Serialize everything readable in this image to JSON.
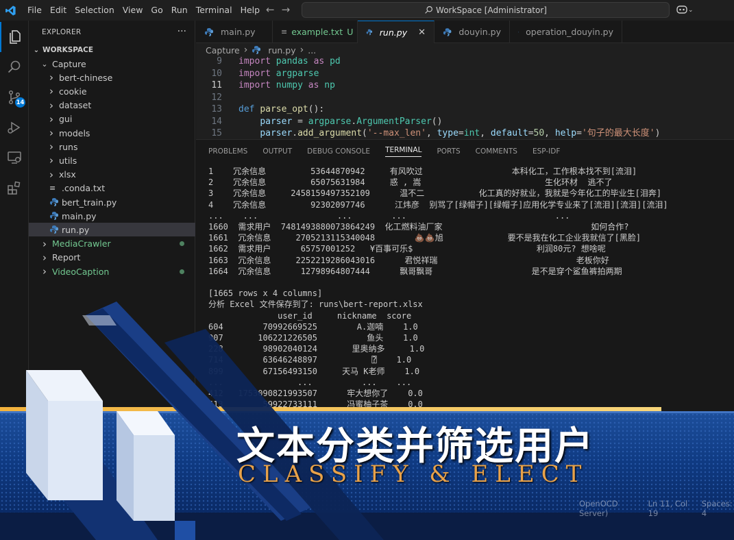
{
  "titlebar": {
    "menu": [
      "File",
      "Edit",
      "Selection",
      "View",
      "Go",
      "Run",
      "Terminal",
      "Help"
    ],
    "search": "WorkSpace [Administrator]"
  },
  "activity": {
    "scm_badge": "14"
  },
  "explorer": {
    "title": "EXPLORER",
    "root": "WORKSPACE",
    "items": [
      {
        "label": "Capture",
        "kind": "folder-open",
        "depth": 1
      },
      {
        "label": "bert-chinese",
        "kind": "folder",
        "depth": 2
      },
      {
        "label": "cookie",
        "kind": "folder",
        "depth": 2
      },
      {
        "label": "dataset",
        "kind": "folder",
        "depth": 2
      },
      {
        "label": "gui",
        "kind": "folder",
        "depth": 2
      },
      {
        "label": "models",
        "kind": "folder",
        "depth": 2
      },
      {
        "label": "runs",
        "kind": "folder",
        "depth": 2
      },
      {
        "label": "utils",
        "kind": "folder",
        "depth": 2
      },
      {
        "label": "xlsx",
        "kind": "folder",
        "depth": 2
      },
      {
        "label": ".conda.txt",
        "kind": "txt",
        "depth": 2
      },
      {
        "label": "bert_train.py",
        "kind": "py",
        "depth": 2
      },
      {
        "label": "main.py",
        "kind": "py",
        "depth": 2
      },
      {
        "label": "run.py",
        "kind": "py",
        "depth": 2,
        "selected": true
      },
      {
        "label": "MediaCrawler",
        "kind": "folder",
        "depth": 1,
        "color": "#73c991",
        "dot": true
      },
      {
        "label": "Report",
        "kind": "folder",
        "depth": 1
      },
      {
        "label": "VideoCaption",
        "kind": "folder",
        "depth": 1,
        "color": "#73c991",
        "dot": true
      }
    ]
  },
  "tabs": [
    {
      "label": "main.py",
      "icon": "python-icon"
    },
    {
      "label": "example.txt",
      "suffix": "U",
      "icon": "txt-icon"
    },
    {
      "label": "run.py",
      "icon": "python-icon",
      "active": true
    },
    {
      "label": "douyin.py",
      "icon": "python-icon"
    },
    {
      "label": "operation_douyin.py",
      "icon": "python-icon"
    }
  ],
  "breadcrumb": [
    "Capture",
    "run.py",
    "..."
  ],
  "editor": {
    "lines": [
      {
        "n": "9",
        "tokens": [
          [
            "kw",
            "import "
          ],
          [
            "mod",
            "pandas"
          ],
          [
            "kw",
            " as "
          ],
          [
            "mod",
            "pd"
          ]
        ]
      },
      {
        "n": "10",
        "tokens": [
          [
            "kw",
            "import "
          ],
          [
            "mod",
            "argparse"
          ]
        ]
      },
      {
        "n": "11",
        "tokens": [
          [
            "kw",
            "import "
          ],
          [
            "mod",
            "numpy"
          ],
          [
            "kw",
            " as "
          ],
          [
            "mod",
            "np"
          ]
        ],
        "current": true
      },
      {
        "n": "12",
        "tokens": []
      },
      {
        "n": "13",
        "tokens": [
          [
            "def",
            "def "
          ],
          [
            "fn",
            "parse_opt"
          ],
          [
            "plain",
            "():"
          ]
        ]
      },
      {
        "n": "14",
        "tokens": [
          [
            "plain",
            "    "
          ],
          [
            "var",
            "parser"
          ],
          [
            "plain",
            " = "
          ],
          [
            "mod",
            "argparse"
          ],
          [
            "plain",
            "."
          ],
          [
            "mod",
            "ArgumentParser"
          ],
          [
            "plain",
            "()"
          ]
        ]
      },
      {
        "n": "15",
        "tokens": [
          [
            "plain",
            "    "
          ],
          [
            "var",
            "parser"
          ],
          [
            "plain",
            "."
          ],
          [
            "fn",
            "add_argument"
          ],
          [
            "plain",
            "("
          ],
          [
            "str",
            "'--max_len'"
          ],
          [
            "plain",
            ", "
          ],
          [
            "var",
            "type"
          ],
          [
            "plain",
            "="
          ],
          [
            "mod",
            "int"
          ],
          [
            "plain",
            ", "
          ],
          [
            "var",
            "default"
          ],
          [
            "plain",
            "="
          ],
          [
            "num",
            "50"
          ],
          [
            "plain",
            ", "
          ],
          [
            "var",
            "help"
          ],
          [
            "plain",
            "="
          ],
          [
            "str",
            "'句子的最大长度'"
          ],
          [
            "plain",
            ")"
          ]
        ]
      }
    ]
  },
  "panel": {
    "tabs": [
      "PROBLEMS",
      "OUTPUT",
      "DEBUG CONSOLE",
      "TERMINAL",
      "PORTS",
      "COMMENTS",
      "ESP-IDF"
    ],
    "active_tab": "TERMINAL",
    "terminal": [
      "1    冗余信息         53644870942     有风吹过                  本科化工，工作根本找不到[流泪]",
      "2    冗余信息         65075631984     惑 , 嵩                         生化环材  逃不了",
      "3    冗余信息     2458159497352109      温不二           化工真的好就业，我就是今年化工的毕业生[泪奔]",
      "4    冗余信息         92302097746      江炜彦  别骂了[绿帽子][绿帽子]应用化学专业来了[流泪][流泪][流泪]",
      "...    ...                ...        ...                              ...",
      "1660  需求用户  7481493880073864249  化工燃料油厂家                              如何合作?",
      "1661  冗余信息     2705213115340048        💩💩旭             要不是我在化工企业我就信了[黑脸]",
      "1662  需求用户      65757001252   ¥百事可乐$                         利润80元? 想啥呢",
      "1663  冗余信息     2252219286043016      君悦祥瑞                            老板你好",
      "1664  冗余信息      12798964807444      飘哥飘哥                    是不是穿个鲨鱼裤拍两期",
      "",
      "[1665 rows x 4 columns]",
      "分析 Excel 文件保存到了: runs\\bert-report.xlsx",
      "              user_id     nickname  score",
      "604        70992669525        A.迦喃    1.0",
      "907       106221226505          鱼头    1.0",
      "228        98902040124       里奥纳多     1.0",
      "714        63646248897           ⍰    1.0",
      "899        67156493150     天马 K老师    1.0",
      "...               ...          ...    ...",
      "412   1753090821993507      牢大想你了    0.0",
      "413        59922733111      冯蜜柚子茶    0.0"
    ]
  },
  "overlay": {
    "title": "文本分类并筛选用户",
    "subtitle": "CLASSIFY & ELECT",
    "status_items": [
      "OpenOCD Server)",
      "Ln 11, Col 19",
      "Spaces: 4"
    ]
  }
}
